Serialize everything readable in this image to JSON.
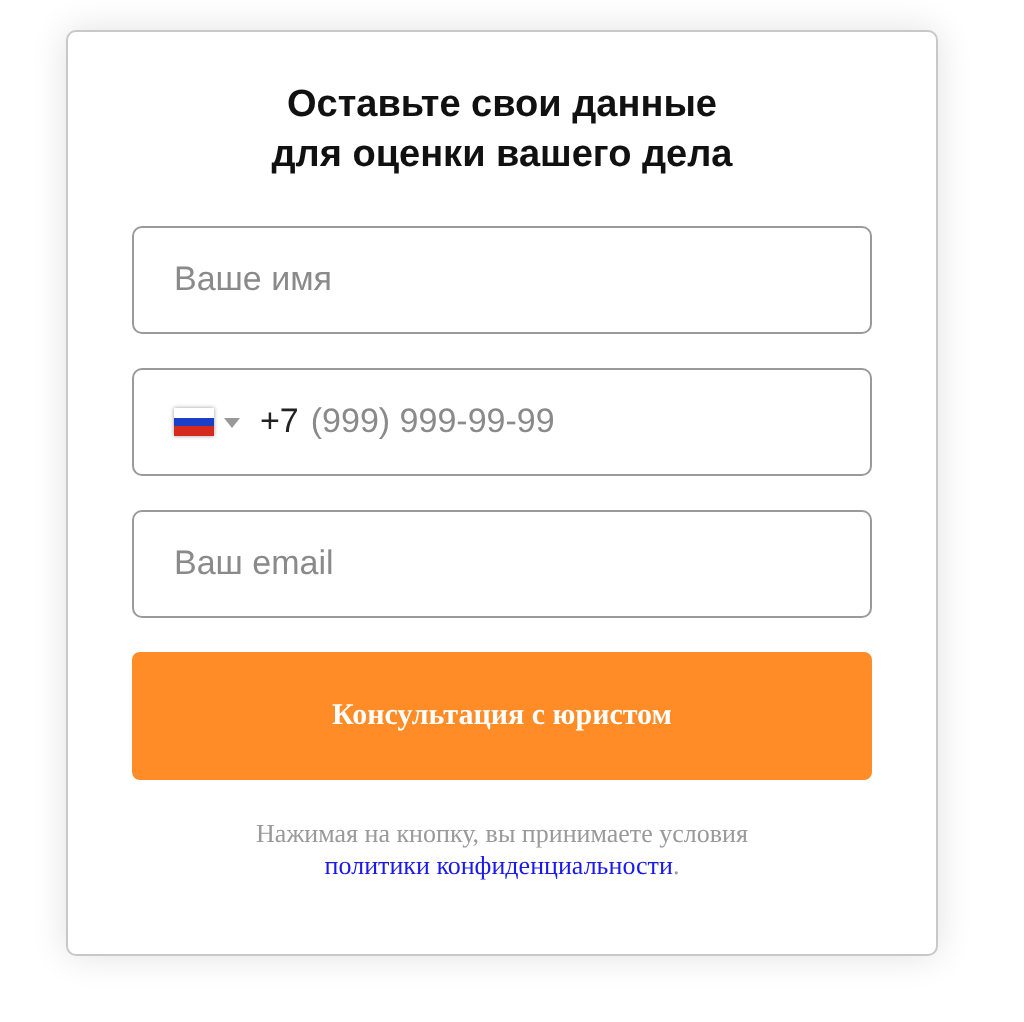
{
  "form": {
    "title": "Оставьте свои данные\nдля оценки вашего дела",
    "fields": [
      {
        "kind": "text",
        "placeholder": "Ваше имя"
      },
      {
        "kind": "phone",
        "value": "+7",
        "placeholder": "(999) 999-99-99"
      },
      {
        "kind": "text",
        "placeholder": "Ваш email"
      }
    ],
    "submit": "Консультация с юристом",
    "consent": {
      "text": "Нажимая на кнопку, вы принимаете условия",
      "link": "политики конфиденциальности",
      "end": "."
    }
  }
}
